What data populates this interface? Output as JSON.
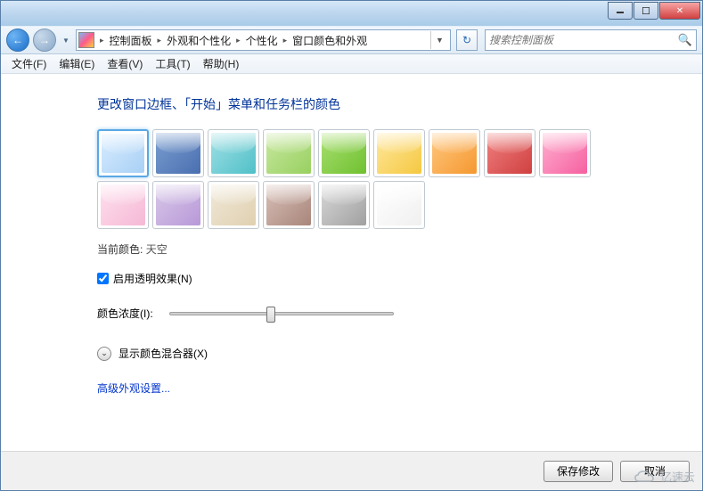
{
  "breadcrumbs": [
    "控制面板",
    "外观和个性化",
    "个性化",
    "窗口颜色和外观"
  ],
  "search": {
    "placeholder": "搜索控制面板"
  },
  "menus": [
    "文件(F)",
    "编辑(E)",
    "查看(V)",
    "工具(T)",
    "帮助(H)"
  ],
  "heading": "更改窗口边框、「开始」菜单和任务栏的颜色",
  "colors": [
    {
      "name": "天空",
      "bg": "linear-gradient(135deg,#d8ecff,#a8d0f5)",
      "selected": true
    },
    {
      "name": "蓝",
      "bg": "linear-gradient(135deg,#7a9ed0,#4a6fb0)"
    },
    {
      "name": "青",
      "bg": "linear-gradient(135deg,#a0e0e5,#50c0c8)"
    },
    {
      "name": "浅绿",
      "bg": "linear-gradient(135deg,#c8e8a0,#98d060)"
    },
    {
      "name": "绿",
      "bg": "linear-gradient(135deg,#a8e070,#70c030)"
    },
    {
      "name": "黄",
      "bg": "linear-gradient(135deg,#ffe8a0,#f5c840)"
    },
    {
      "name": "橙",
      "bg": "linear-gradient(135deg,#ffc880,#f59830)"
    },
    {
      "name": "红",
      "bg": "linear-gradient(135deg,#f08080,#d04040)"
    },
    {
      "name": "玫红",
      "bg": "linear-gradient(135deg,#ffb0d0,#f560a0)"
    },
    {
      "name": "粉",
      "bg": "linear-gradient(135deg,#ffe0ee,#f5b8d5)"
    },
    {
      "name": "紫",
      "bg": "linear-gradient(135deg,#d8c8e8,#b898d8)"
    },
    {
      "name": "米",
      "bg": "linear-gradient(135deg,#f0e8d8,#e0d0b0)"
    },
    {
      "name": "棕",
      "bg": "linear-gradient(135deg,#d8c0b8,#a8857a)"
    },
    {
      "name": "灰",
      "bg": "linear-gradient(135deg,#d8d8d8,#a0a0a0)"
    },
    {
      "name": "白",
      "bg": "linear-gradient(135deg,#ffffff,#f0f0f0)"
    }
  ],
  "current_label": "当前颜色:",
  "current_value": "天空",
  "transparency": {
    "label": "启用透明效果(N)",
    "checked": true
  },
  "intensity_label": "颜色浓度(I):",
  "mixer_label": "显示颜色混合器(X)",
  "advanced_link": "高级外观设置...",
  "buttons": {
    "save": "保存修改",
    "cancel": "取消"
  },
  "watermark": "亿速云"
}
